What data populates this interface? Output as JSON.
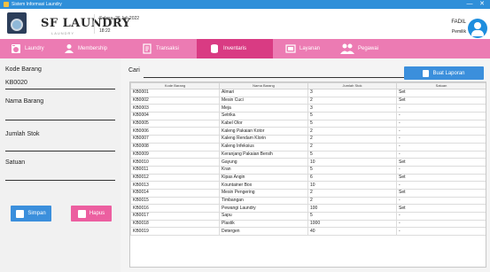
{
  "window": {
    "title": "Sistem Informasi Laundry",
    "minimize": "—",
    "close": "✕"
  },
  "header": {
    "app_name": "SF LAUNDRY",
    "app_sub": "LAUNDRY",
    "date": "Selasa, 26 Juli 2022",
    "time": "18:22",
    "user_name": "FADIL",
    "user_role": "Pemilik"
  },
  "nav": [
    {
      "label": "Laundry",
      "icon": "laundry-icon"
    },
    {
      "label": "Membership",
      "icon": "person-icon"
    },
    {
      "label": "Transaksi",
      "icon": "transaction-icon"
    },
    {
      "label": "Inventaris",
      "icon": "inventory-icon",
      "active": true
    },
    {
      "label": "Layanan",
      "icon": "service-icon"
    },
    {
      "label": "Pegawai",
      "icon": "staff-icon"
    }
  ],
  "form": {
    "kode_label": "Kode Barang",
    "kode_value": "KB0020",
    "nama_label": "Nama Barang",
    "nama_value": "",
    "stok_label": "Jumlah Stok",
    "stok_value": "",
    "satuan_label": "Satuan",
    "satuan_value": "",
    "save_label": "Simpan",
    "delete_label": "Hapus"
  },
  "search": {
    "label": "Cari",
    "value": ""
  },
  "report_button": "Buat Laporan",
  "table": {
    "headers": [
      "Kode Barang",
      "Nama Barang",
      "Jumlah Stok",
      "Satuan"
    ],
    "rows": [
      [
        "KB0001",
        "Almari",
        "3",
        "Set"
      ],
      [
        "KB0002",
        "Mesin Cuci",
        "2",
        "Set"
      ],
      [
        "KB0003",
        "Meja",
        "3",
        "-"
      ],
      [
        "KB0004",
        "Setrika",
        "5",
        "-"
      ],
      [
        "KB0005",
        "Kabel Olor",
        "5",
        "-"
      ],
      [
        "KB0006",
        "Kaleng Pakaian Kotor",
        "2",
        "-"
      ],
      [
        "KB0007",
        "Kaleng Rendam Klorin",
        "2",
        "-"
      ],
      [
        "KB0008",
        "Kaleng Infeksius",
        "2",
        "-"
      ],
      [
        "KB0009",
        "Keranjang Pakaian Bersih",
        "5",
        "-"
      ],
      [
        "KB0010",
        "Gayung",
        "10",
        "Set"
      ],
      [
        "KB0011",
        "Kran",
        "5",
        "-"
      ],
      [
        "KB0012",
        "Kipas Angin",
        "6",
        "Set"
      ],
      [
        "KB0013",
        "Kountainer Box",
        "10",
        "-"
      ],
      [
        "KB0014",
        "Mesin Pengering",
        "2",
        "Set"
      ],
      [
        "KB0015",
        "Timbangan",
        "2",
        "-"
      ],
      [
        "KB0016",
        "Pewangi Laundry",
        "100",
        "Set"
      ],
      [
        "KB0017",
        "Sapu",
        "5",
        "-"
      ],
      [
        "KB0018",
        "Plastik",
        "1000",
        "-"
      ],
      [
        "KB0019",
        "Detergen",
        "40",
        "-"
      ]
    ]
  },
  "colors": {
    "nav_bg": "#ec7bb3",
    "nav_active": "#d93b83",
    "primary_button": "#3b8fdc",
    "danger_button": "#ec5fa0"
  }
}
